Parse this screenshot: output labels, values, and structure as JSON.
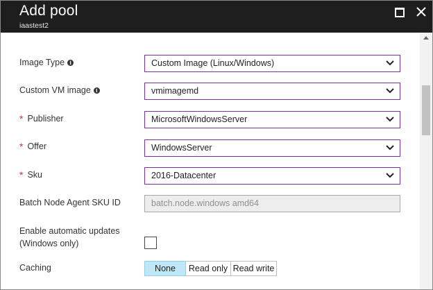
{
  "window": {
    "title": "Add pool",
    "subtitle": "iaastest2",
    "maximize_icon": "maximize-icon",
    "close_icon": "close-icon"
  },
  "form": {
    "image_type": {
      "label": "Image Type",
      "value": "Custom Image (Linux/Windows)",
      "required": false,
      "info": true
    },
    "custom_vm_image": {
      "label": "Custom VM image",
      "value": "vmimagemd",
      "required": false,
      "info": true
    },
    "publisher": {
      "label": "Publisher",
      "value": "MicrosoftWindowsServer",
      "required": true
    },
    "offer": {
      "label": "Offer",
      "value": "WindowsServer",
      "required": true
    },
    "sku": {
      "label": "Sku",
      "value": "2016-Datacenter",
      "required": true
    },
    "node_agent_sku": {
      "label": "Batch Node Agent SKU ID",
      "value": "batch.node.windows amd64",
      "readonly": true
    },
    "auto_updates": {
      "label_line1": "Enable automatic updates",
      "label_line2": "(Windows only)",
      "checked": false
    },
    "caching": {
      "label": "Caching",
      "options": [
        "None",
        "Read only",
        "Read write"
      ],
      "selected": "None"
    },
    "required_marker": "*",
    "info_glyph": "i"
  },
  "colors": {
    "titlebar": "#1e1e1e",
    "select_border": "#7b2fa3",
    "required": "#d13438",
    "selected_option": "#bfe7f7"
  }
}
